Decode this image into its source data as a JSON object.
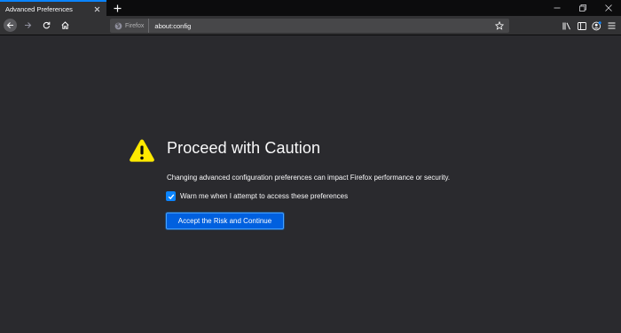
{
  "tabs": [
    {
      "title": "Advanced Preferences",
      "active": true
    }
  ],
  "navbar": {
    "identity_label": "Firefox",
    "url": "about:config"
  },
  "icons": {
    "tab_close": "close-icon",
    "new_tab": "plus-icon",
    "minimize": "minimize-icon",
    "restore": "restore-icon",
    "close_window": "close-window-icon",
    "back": "back-arrow-icon",
    "forward": "forward-arrow-icon",
    "reload": "reload-icon",
    "home": "home-icon",
    "firefox": "firefox-logo-icon",
    "bookmark": "star-icon",
    "library": "library-icon",
    "sidebar": "sidebar-icon",
    "account": "account-icon",
    "menu": "hamburger-menu-icon",
    "warning": "warning-triangle-icon",
    "check": "checkmark-icon"
  },
  "main": {
    "title": "Proceed with Caution",
    "description": "Changing advanced configuration preferences can impact Firefox performance or security.",
    "checkbox_label": "Warn me when I attempt to access these preferences",
    "checkbox_checked": true,
    "accept_button": "Accept the Risk and Continue"
  },
  "colors": {
    "background": "#2a2a2e",
    "accent": "#0a84ff",
    "button": "#0060df",
    "warning": "#ffe900"
  }
}
